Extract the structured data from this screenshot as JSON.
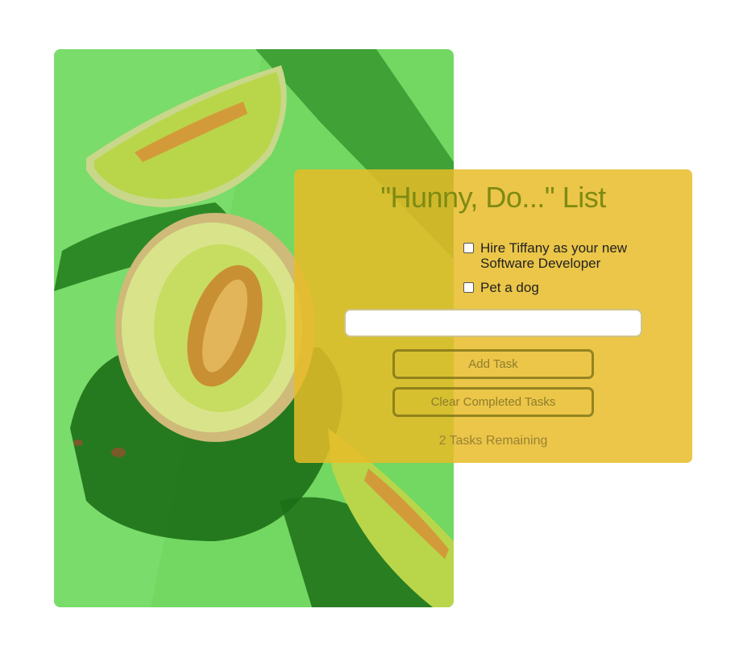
{
  "colors": {
    "page_background": "#ffffff",
    "photo_background": "#6fd35f",
    "card_background": "#e8bc28",
    "title_color": "#7f8a12"
  },
  "photo": {
    "subject": "melon slices on green background"
  },
  "todo": {
    "title": "\"Hunny, Do...\" List",
    "tasks": [
      {
        "label": "Hire Tiffany as your new Software Developer",
        "checked": false
      },
      {
        "label": "Pet a dog",
        "checked": false
      }
    ],
    "input": {
      "value": "",
      "placeholder": ""
    },
    "add_button": "Add Task",
    "clear_button": "Clear Completed Tasks",
    "remaining_count": "2",
    "remaining_label": "Tasks Remaining"
  }
}
